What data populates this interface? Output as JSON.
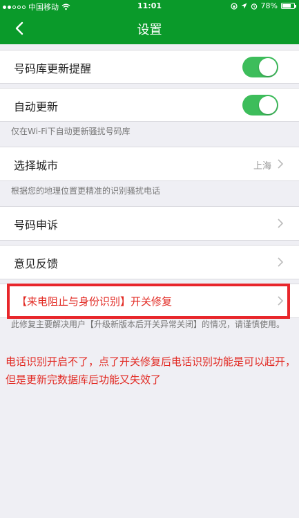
{
  "status_bar": {
    "carrier": "中国移动",
    "time": "11:01",
    "battery": "78%",
    "battery_level": 0.78
  },
  "nav": {
    "title": "设置"
  },
  "settings": {
    "update_reminder": {
      "label": "号码库更新提醒",
      "enabled": true
    },
    "auto_update": {
      "label": "自动更新",
      "enabled": true,
      "note": "仅在Wi-Fi下自动更新骚扰号码库"
    },
    "city": {
      "label": "选择城市",
      "value": "上海",
      "note": "根据您的地理位置更精准的识别骚扰电话"
    },
    "appeal": {
      "label": "号码申诉"
    },
    "feedback": {
      "label": "意见反馈"
    },
    "repair": {
      "label": "【来电阻止与身份识别】开关修复",
      "note": "此修复主要解决用户【升级新版本后开关异常关闭】的情况，请谨慎使用。"
    }
  },
  "annotation": {
    "text": "电话识别开启不了，点了开关修复后电话识别功能是可以起开，但是更新完数据库后功能又失效了"
  },
  "colors": {
    "brand": "#0a9a2a",
    "toggle_on": "#3dbd5b",
    "highlight": "#e8262b"
  }
}
